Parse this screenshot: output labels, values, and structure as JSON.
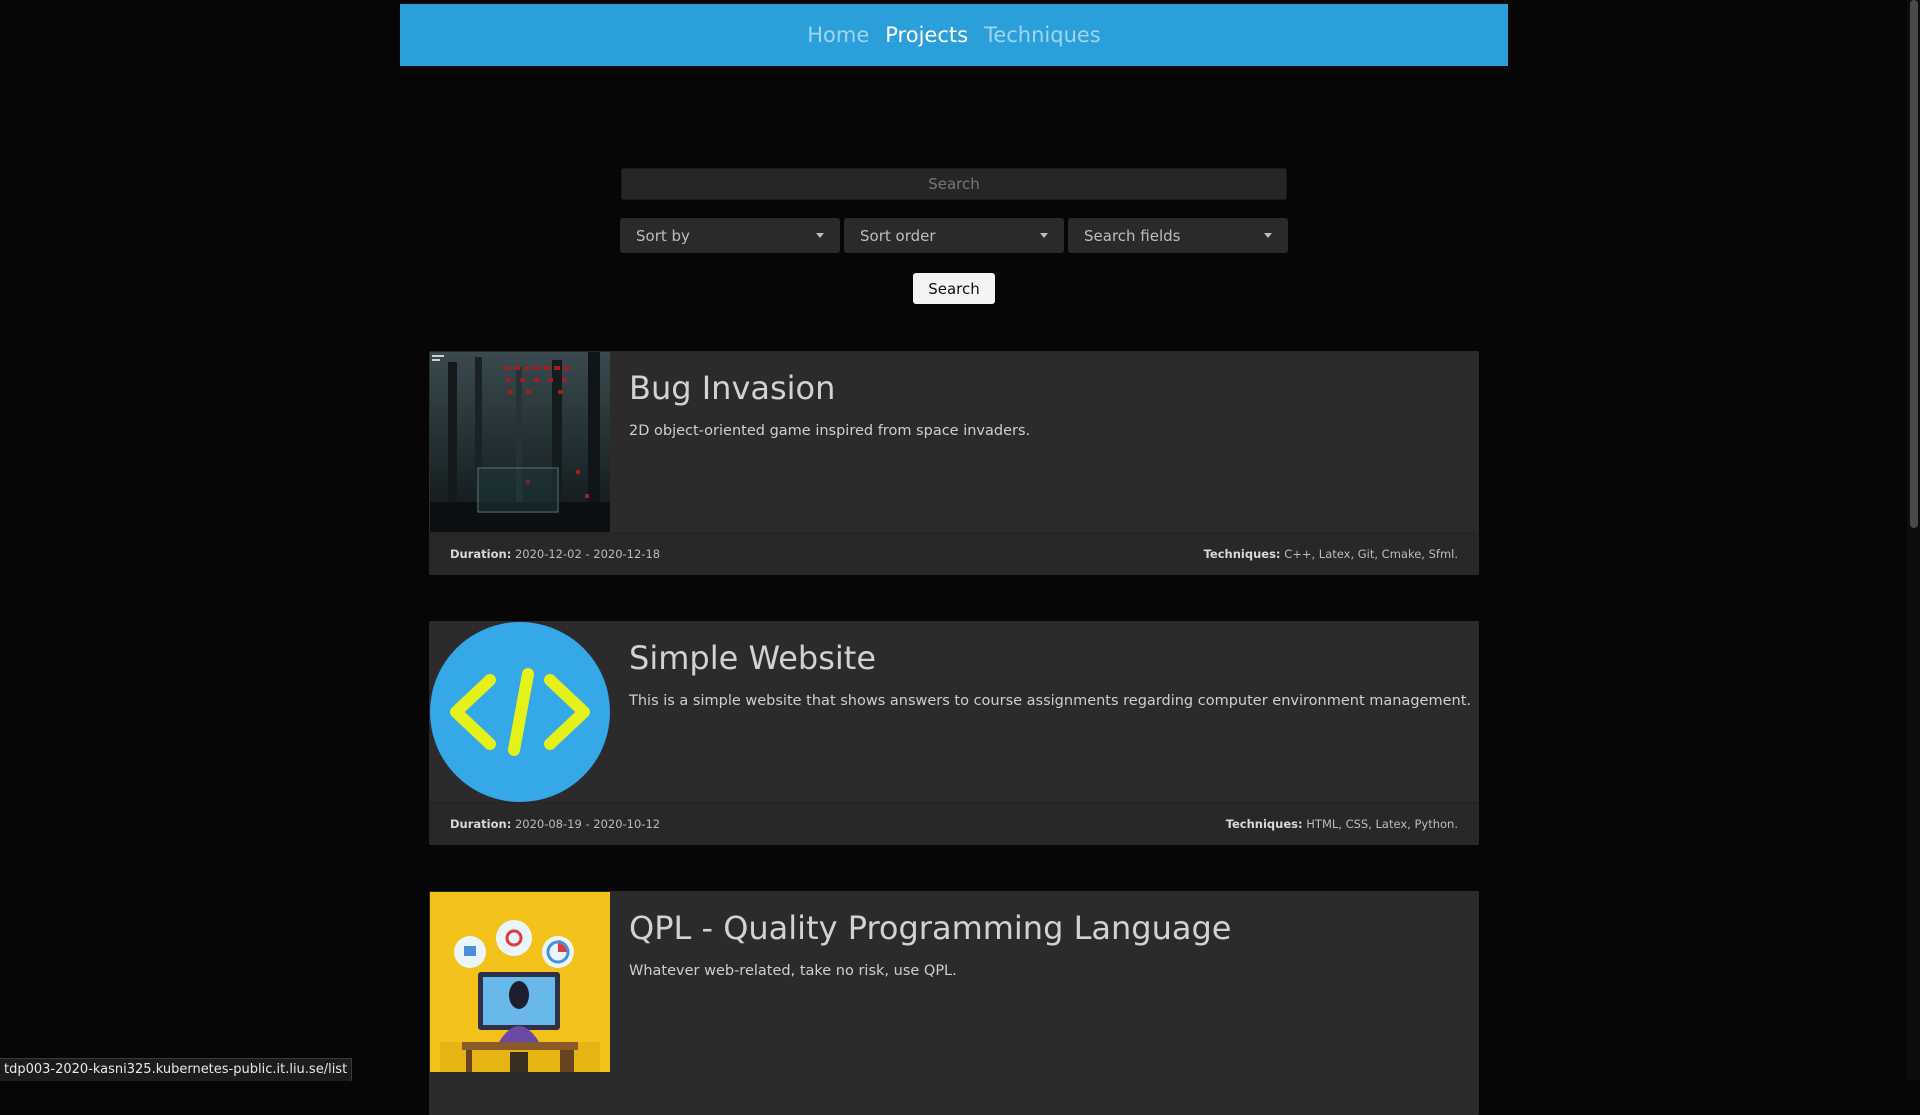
{
  "nav": {
    "items": [
      {
        "label": "Home",
        "active": false
      },
      {
        "label": "Projects",
        "active": true
      },
      {
        "label": "Techniques",
        "active": false
      }
    ],
    "background": "#2b9fd9"
  },
  "search": {
    "placeholder": "Search",
    "sort_by_label": "Sort by",
    "sort_order_label": "Sort order",
    "search_fields_label": "Search fields",
    "button_label": "Search"
  },
  "projects": [
    {
      "title": "Bug Invasion",
      "description": "2D object-oriented game inspired from space invaders.",
      "duration_label": "Duration:",
      "duration": "2020-12-02 - 2020-12-18",
      "techniques_label": "Techniques:",
      "techniques": "C++, Latex, Git, Cmake, Sfml.",
      "image_icon": "game-screenshot-image"
    },
    {
      "title": "Simple Website",
      "description": "This is a simple website that shows answers to course assignments regarding computer environment management.",
      "duration_label": "Duration:",
      "duration": "2020-08-19 - 2020-10-12",
      "techniques_label": "Techniques:",
      "techniques": "HTML, CSS, Latex, Python.",
      "image_icon": "code-brackets-image"
    },
    {
      "title": "QPL - Quality Programming Language",
      "description": "Whatever web-related, take no risk, use QPL.",
      "image_icon": "programmer-illustration-image"
    }
  ],
  "status_bar": {
    "url": "tdp003-2020-kasni325.kubernetes-public.it.liu.se/list"
  }
}
